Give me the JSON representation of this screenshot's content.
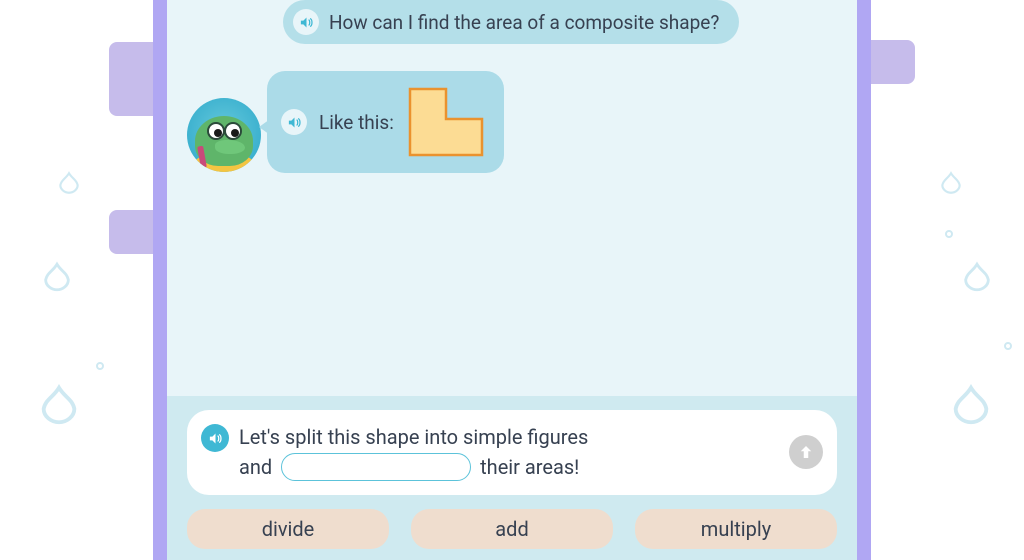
{
  "chat": {
    "question": "How can I find the area of a composite shape?",
    "response_prefix": "Like this:"
  },
  "prompt": {
    "line1": "Let's split this shape into simple figures",
    "line2_before": "and",
    "line2_after": "their areas!"
  },
  "options": {
    "opt1": "divide",
    "opt2": "add",
    "opt3": "multiply"
  },
  "icons": {
    "speaker": "speaker-icon",
    "arrow_up": "arrow-up-icon"
  }
}
